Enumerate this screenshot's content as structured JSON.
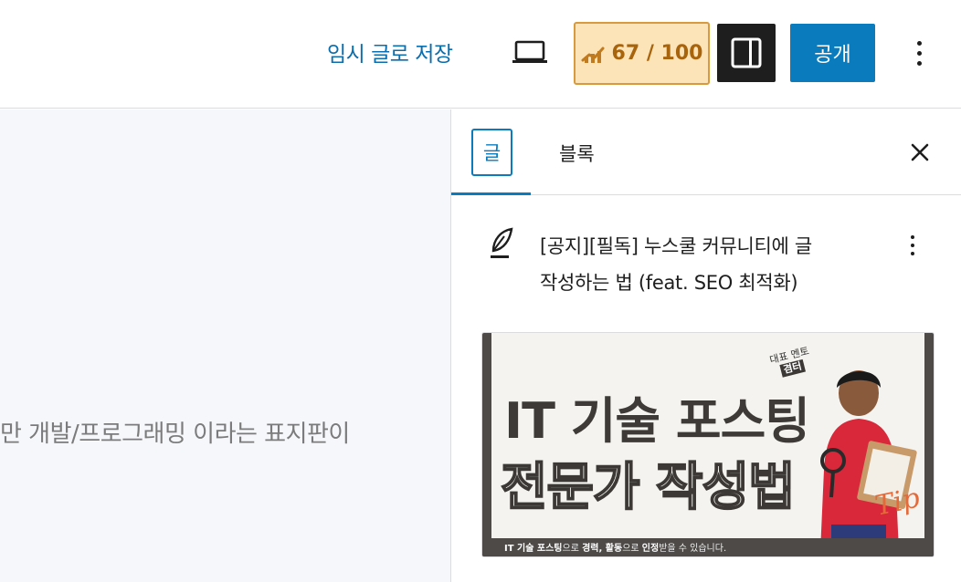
{
  "header": {
    "save_draft_label": "임시 글로 저장",
    "seo_score": "67 / 100",
    "publish_label": "공개"
  },
  "canvas": {
    "visible_text": "만 개발/프로그래밍 이라는 표지판이"
  },
  "sidebar": {
    "tab_post_label": "글",
    "tab_block_label": "블록",
    "post_title_line1": "[공지][필독] 누스쿨 커뮤니티에 글",
    "post_title_line2": "작성하는 법 (feat. SEO 최적화)",
    "featured_image": {
      "line1": "IT 기술 포스팅",
      "line2": "전문가 작성법",
      "mentor_top": "대표 멘토",
      "mentor_name": "겸터",
      "caption_part1": "IT 기술 포스팅",
      "caption_part2": "으로 ",
      "caption_part3": "경력, 활동",
      "caption_part4": "으로 ",
      "caption_part5": "인정",
      "caption_part6": "받을 수 있습니다.",
      "tip_text": "Tip"
    }
  },
  "colors": {
    "accent": "#0a7bbd",
    "seo_bg": "#fde4b8",
    "seo_text": "#a8630d",
    "dark": "#1e1e1e"
  },
  "icons": [
    "laptop-icon",
    "seo-chart-icon",
    "sidebar-toggle-icon",
    "more-vertical-icon",
    "close-icon",
    "feather-pen-icon"
  ]
}
